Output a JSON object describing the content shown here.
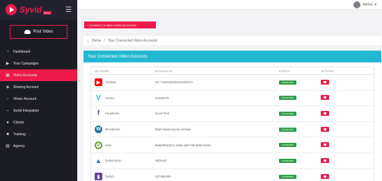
{
  "app": {
    "brand": "Syvid",
    "badge": "beta"
  },
  "topbar": {
    "user_name": "Admin"
  },
  "sidebar": {
    "post_button": "Post Video",
    "items": [
      {
        "label": "Dashboard",
        "icon": "gauge-icon"
      },
      {
        "label": "Your Campaigns",
        "icon": "play-icon"
      },
      {
        "label": "Video Accounts",
        "icon": "video-icon",
        "active": true
      },
      {
        "label": "Sharing Account",
        "icon": "share-icon"
      },
      {
        "label": "Vimeo Account",
        "icon": "dash-icon"
      },
      {
        "label": "Syvid Integration",
        "icon": "dash-icon"
      },
      {
        "label": "Clients",
        "icon": "users-icon"
      },
      {
        "label": "Training",
        "icon": "book-icon"
      },
      {
        "label": "Agency",
        "icon": "briefcase-icon"
      }
    ]
  },
  "main": {
    "connect_button": "+ CONNECT A NEW VIDEO ACCOUNT",
    "breadcrumb": {
      "home": "Home",
      "current": "Your Connected Video Accounts"
    },
    "panel_title": "Your Connected Video Accounts",
    "table": {
      "headers": [
        "NETWORK",
        "ACCOUNT ID",
        "STATUS",
        "ACTIONS"
      ],
      "rows": [
        {
          "network": "Youtube",
          "account_id": "UC-Yxw9ej0Rd1k0eNhxt7z",
          "status": "Connected",
          "icon": "youtube-icon",
          "color": "#ff0000"
        },
        {
          "network": "Vimeo",
          "account_id": "12345678",
          "status": "Connected",
          "icon": "vimeo-icon",
          "color": "#1ab7ea"
        },
        {
          "network": "Facebook",
          "account_id": "Syvid Test",
          "status": "Connected",
          "icon": "facebook-icon",
          "color": "#3b5998"
        },
        {
          "network": "Wordpress",
          "account_id": "https://www.syvid.com/wp",
          "status": "Connected",
          "icon": "wordpress-icon",
          "color": "#21759b"
        },
        {
          "network": "Vine",
          "account_id": "9e8b4f0a32c1-4d5b-a6f7-88c9d0e1f2a3",
          "status": "Connected",
          "icon": "vine-icon",
          "color": "#6b9e2f"
        },
        {
          "network": "Dailymotion",
          "account_id": "x5b3xyd",
          "status": "Connected",
          "icon": "dailymotion-icon",
          "color": "#0066dc"
        },
        {
          "network": "Twitch",
          "account_id": "157385490",
          "status": "Connected",
          "icon": "twitch-icon",
          "color": "#6441a5"
        }
      ]
    }
  }
}
